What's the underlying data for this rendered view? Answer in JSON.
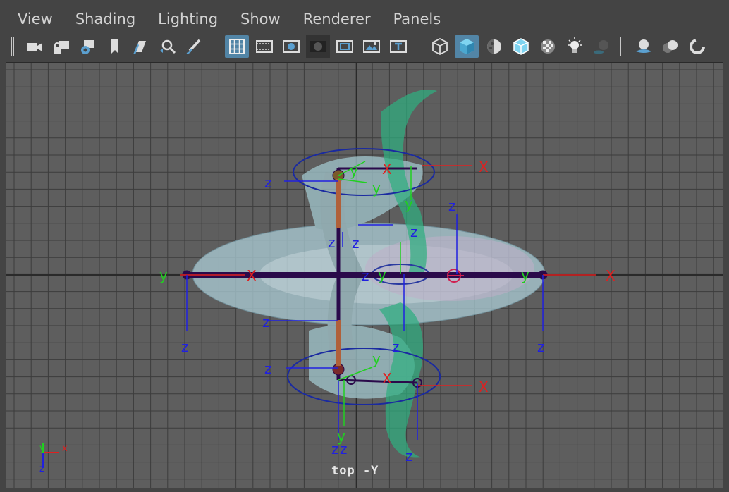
{
  "menu": {
    "items": [
      {
        "label": "View"
      },
      {
        "label": "Shading"
      },
      {
        "label": "Lighting"
      },
      {
        "label": "Show"
      },
      {
        "label": "Renderer"
      },
      {
        "label": "Panels"
      }
    ]
  },
  "toolbar": {
    "buttons": [
      {
        "icon": "camera-icon",
        "active": false
      },
      {
        "icon": "camera-lock-icon",
        "active": false
      },
      {
        "icon": "camera-attributes-icon",
        "active": false
      },
      {
        "icon": "bookmark-icon",
        "active": false
      },
      {
        "icon": "image-plane-icon",
        "active": false
      },
      {
        "icon": "2d-pan-zoom-icon",
        "active": false
      },
      {
        "icon": "grease-pencil-icon",
        "active": false
      },
      {
        "icon": "grid-icon",
        "active": true
      },
      {
        "icon": "film-gate-icon",
        "active": false
      },
      {
        "icon": "resolution-gate-icon",
        "active": false
      },
      {
        "icon": "gate-mask-icon",
        "active": false
      },
      {
        "icon": "field-chart-icon",
        "active": false
      },
      {
        "icon": "safe-action-icon",
        "active": false
      },
      {
        "icon": "safe-title-icon",
        "active": false
      },
      {
        "icon": "wireframe-icon",
        "active": false
      },
      {
        "icon": "smooth-shade-icon",
        "active": true
      },
      {
        "icon": "default-material-icon",
        "active": false
      },
      {
        "icon": "wireframe-on-shaded-icon",
        "active": false
      },
      {
        "icon": "textured-icon",
        "active": false
      },
      {
        "icon": "lights-icon",
        "active": false
      },
      {
        "icon": "shadows-icon",
        "active": false
      },
      {
        "icon": "ambient-occlusion-icon",
        "active": false
      },
      {
        "icon": "motion-blur-icon",
        "active": false
      },
      {
        "icon": "anti-aliasing-icon",
        "active": false
      }
    ]
  },
  "viewport": {
    "camera_label": "top -Y",
    "axis_gizmo": {
      "y": "y",
      "x": "x",
      "z": "z"
    },
    "joint_axis_labels": {
      "x": "X",
      "y": "y",
      "z": "z"
    }
  },
  "colors": {
    "background": "#444444",
    "viewport": "#5e5e5e",
    "grid": "#3a3a3a",
    "axis_line": "#2a2a2a",
    "active_button": "#5285a6",
    "x_axis": "#e02020",
    "y_axis": "#20d020",
    "z_axis": "#2020e0",
    "bone": "#2a0a4a",
    "mesh": "#b8d8e0",
    "ribbon": "#2fae80"
  }
}
